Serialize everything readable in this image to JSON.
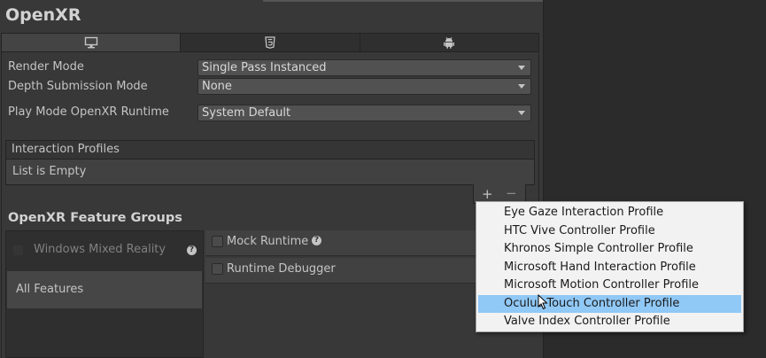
{
  "window": {
    "title": "OpenXR"
  },
  "platform_tabs": [
    {
      "icon": "desktop-icon",
      "active": true
    },
    {
      "icon": "html5-icon",
      "active": false
    },
    {
      "icon": "android-icon",
      "active": false
    }
  ],
  "settings": [
    {
      "label": "Render Mode",
      "value": "Single Pass Instanced"
    },
    {
      "label": "Depth Submission Mode",
      "value": "None"
    },
    {
      "label": "Play Mode OpenXR Runtime",
      "value": "System Default"
    }
  ],
  "interaction_profiles": {
    "header": "Interaction Profiles",
    "empty_text": "List is Empty",
    "add_label": "+",
    "remove_label": "−"
  },
  "feature_groups": {
    "title": "OpenXR Feature Groups",
    "groups": [
      {
        "label": "Windows Mixed Reality",
        "enabled": false,
        "has_help": true
      },
      {
        "label": "All Features",
        "selected": true
      }
    ],
    "features": [
      {
        "label": "Mock Runtime",
        "checked": false,
        "has_help": true
      },
      {
        "label": "Runtime Debugger",
        "checked": false,
        "has_help": false
      }
    ]
  },
  "profile_menu": {
    "items": [
      "Eye Gaze Interaction Profile",
      "HTC Vive Controller Profile",
      "Khronos Simple Controller Profile",
      "Microsoft Hand Interaction Profile",
      "Microsoft Motion Controller Profile",
      "Oculus Touch Controller Profile",
      "Valve Index Controller Profile"
    ],
    "highlighted_index": 5
  },
  "help_glyph": "?",
  "colors": {
    "highlight": "#90c8f6",
    "panel": "#383838",
    "menu_bg": "#f2f2f2"
  }
}
